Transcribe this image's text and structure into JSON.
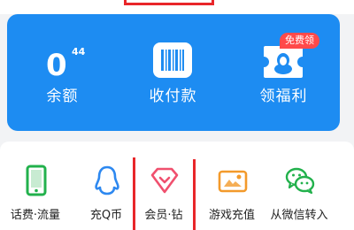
{
  "wallet": {
    "balance": {
      "value": "0",
      "superscript": "44",
      "label": "余额"
    },
    "pay": {
      "label": "收付款"
    },
    "benefits": {
      "label": "领福利",
      "badge": "免费领"
    }
  },
  "services": [
    {
      "label": "话费·流量",
      "icon": "phone-icon"
    },
    {
      "label": "充Q币",
      "icon": "qq-penguin-icon"
    },
    {
      "label": "会员·钻",
      "icon": "diamond-icon"
    },
    {
      "label": "游戏充值",
      "icon": "game-icon"
    },
    {
      "label": "从微信转入",
      "icon": "wechat-icon"
    }
  ],
  "colors": {
    "card_blue": "#1d8cf2",
    "annotation_red": "#e8262a",
    "badge_red": "#ff4a4a",
    "green": "#22b14c",
    "blue_icon": "#2d88f0",
    "pink": "#f0506e",
    "orange": "#f39a2b"
  }
}
